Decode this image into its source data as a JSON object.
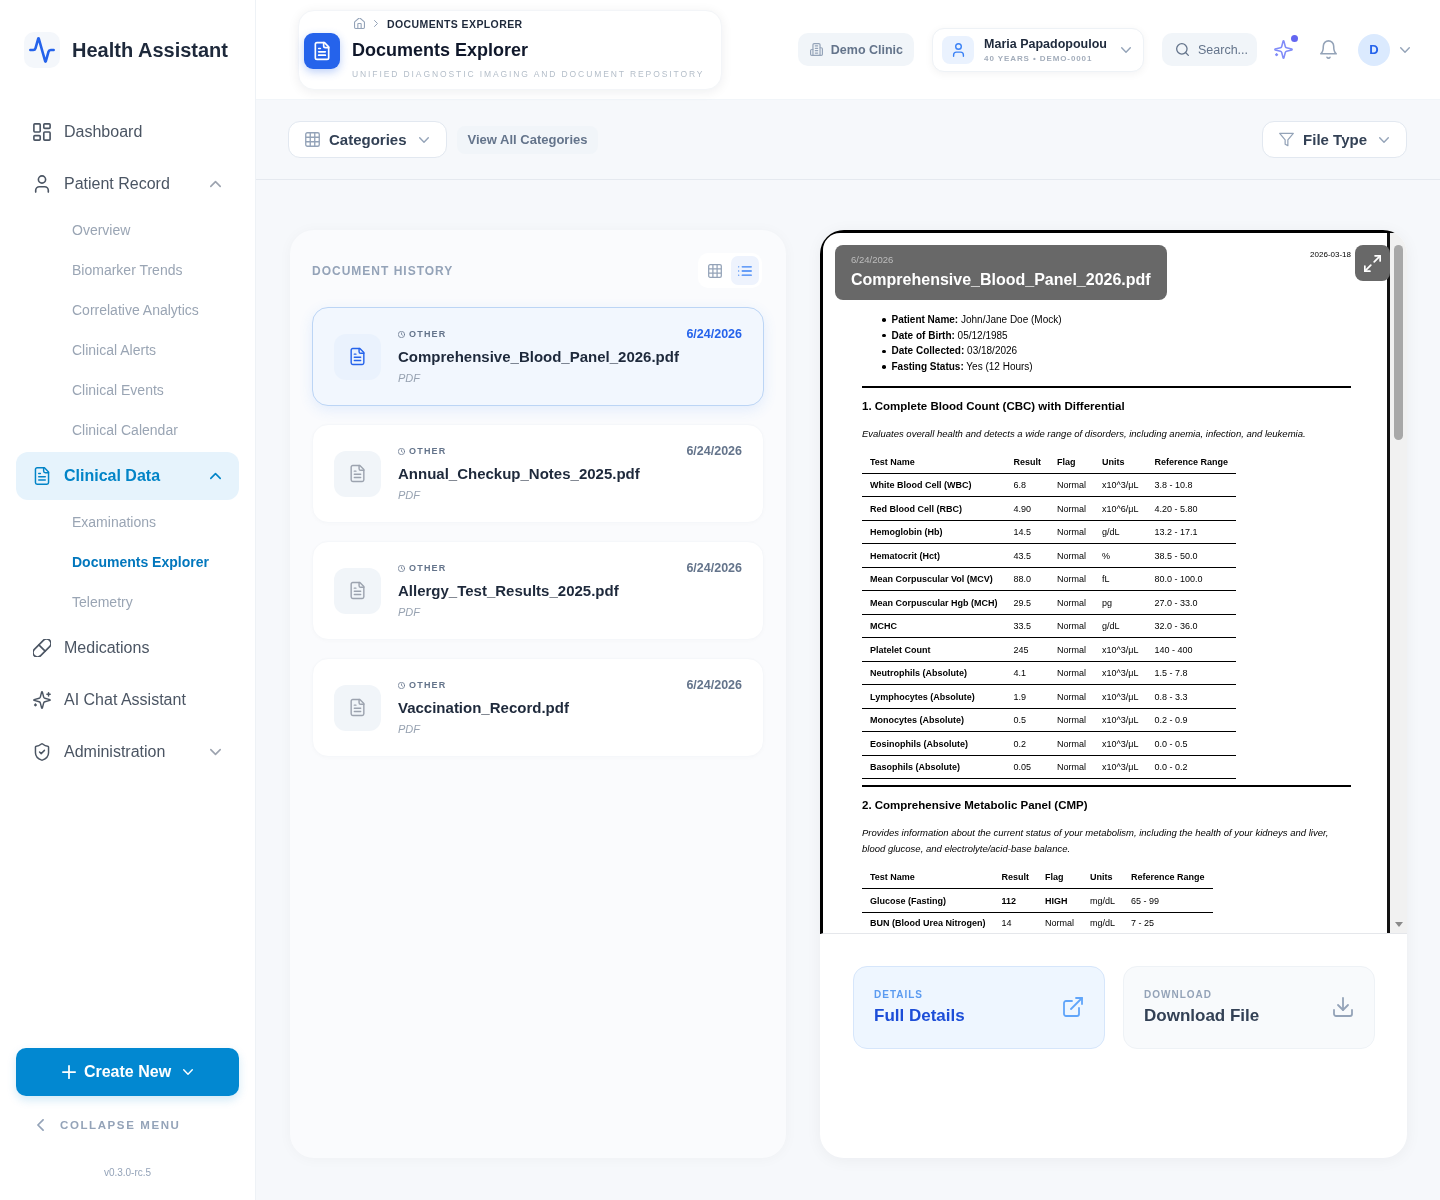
{
  "sidebar": {
    "brand": "Health Assistant",
    "nav": [
      {
        "kind": "link",
        "label": "Dashboard",
        "selected": false
      },
      {
        "kind": "group",
        "label": "Patient Record",
        "selected": false,
        "expanded": true,
        "children": [
          {
            "label": "Overview",
            "selected": false
          },
          {
            "label": "Biomarker Trends",
            "selected": false
          },
          {
            "label": "Correlative Analytics",
            "selected": false
          },
          {
            "label": "Clinical Alerts",
            "selected": false
          },
          {
            "label": "Clinical Events",
            "selected": false
          },
          {
            "label": "Clinical Calendar",
            "selected": false
          }
        ]
      },
      {
        "kind": "group",
        "label": "Clinical Data",
        "selected": true,
        "expanded": true,
        "children": [
          {
            "label": "Examinations",
            "selected": false
          },
          {
            "label": "Documents Explorer",
            "selected": true
          },
          {
            "label": "Telemetry",
            "selected": false
          }
        ]
      },
      {
        "kind": "link",
        "label": "Medications",
        "selected": false
      },
      {
        "kind": "link",
        "label": "AI Chat Assistant",
        "selected": false
      },
      {
        "kind": "group",
        "label": "Administration",
        "selected": false,
        "expanded": false
      }
    ],
    "create_button": "Create New",
    "collapse_label": "COLLAPSE MENU",
    "version": "v0.3.0-rc.5"
  },
  "header": {
    "breadcrumb": "DOCUMENTS EXPLORER",
    "title": "Documents Explorer",
    "subtitle": "UNIFIED DIAGNOSTIC IMAGING AND DOCUMENT REPOSITORY",
    "clinic": "Demo Clinic",
    "patient": {
      "name": "Maria Papadopoulou",
      "details": "40 YEARS • DEMO-0001"
    },
    "search": {
      "placeholder": "Search..."
    },
    "assistant_unread": true,
    "avatar": "D"
  },
  "toolbar": {
    "categories": "Categories",
    "view_all": "View All Categories",
    "file_type": "File Type"
  },
  "documents": {
    "heading": "DOCUMENT HISTORY",
    "view_modes": [
      {
        "kind": "grid",
        "selected": false
      },
      {
        "kind": "list",
        "selected": true
      }
    ],
    "items": [
      {
        "category": "OTHER",
        "name": "Comprehensive_Blood_Panel_2026.pdf",
        "type": "PDF",
        "date": "6/24/2026",
        "selected": true
      },
      {
        "category": "OTHER",
        "name": "Annual_Checkup_Notes_2025.pdf",
        "type": "PDF",
        "date": "6/24/2026",
        "selected": false
      },
      {
        "category": "OTHER",
        "name": "Allergy_Test_Results_2025.pdf",
        "type": "PDF",
        "date": "6/24/2026",
        "selected": false
      },
      {
        "category": "OTHER",
        "name": "Vaccination_Record.pdf",
        "type": "PDF",
        "date": "6/24/2026",
        "selected": false
      }
    ]
  },
  "preview": {
    "date": "6/24/2026",
    "title": "Comprehensive_Blood_Panel_2026.pdf",
    "document": {
      "date": "2026-03-18",
      "fields": [
        "**Patient Name:** John/Jane Doe (Mock)",
        "**Date of Birth:** 05/12/1985",
        "**Date Collected:** 03/18/2026",
        "**Fasting Status:** Yes (12 Hours)"
      ],
      "sections": [
        {
          "title": "1. Complete Blood Count (CBC) with Differential",
          "description": "Evaluates overall health and detects a wide range of disorders, including anemia, infection, and leukemia.",
          "columns": [
            "Test Name",
            "Result",
            "Flag",
            "Units",
            "Reference Range"
          ],
          "rows": [
            {
              "cells": [
                "White Blood Cell (WBC)",
                "6.8",
                "Normal",
                "x10^3/μL",
                "3.8 - 10.8"
              ],
              "abnormal": false
            },
            {
              "cells": [
                "Red Blood Cell (RBC)",
                "4.90",
                "Normal",
                "x10^6/μL",
                "4.20 - 5.80"
              ],
              "abnormal": false
            },
            {
              "cells": [
                "Hemoglobin (Hb)",
                "14.5",
                "Normal",
                "g/dL",
                "13.2 - 17.1"
              ],
              "abnormal": false
            },
            {
              "cells": [
                "Hematocrit (Hct)",
                "43.5",
                "Normal",
                "%",
                "38.5 - 50.0"
              ],
              "abnormal": false
            },
            {
              "cells": [
                "Mean Corpuscular Vol (MCV)",
                "88.0",
                "Normal",
                "fL",
                "80.0 - 100.0"
              ],
              "abnormal": false
            },
            {
              "cells": [
                "Mean Corpuscular Hgb (MCH)",
                "29.5",
                "Normal",
                "pg",
                "27.0 - 33.0"
              ],
              "abnormal": false
            },
            {
              "cells": [
                "MCHC",
                "33.5",
                "Normal",
                "g/dL",
                "32.0 - 36.0"
              ],
              "abnormal": false
            },
            {
              "cells": [
                "Platelet Count",
                "245",
                "Normal",
                "x10^3/μL",
                "140 - 400"
              ],
              "abnormal": false
            },
            {
              "cells": [
                "Neutrophils (Absolute)",
                "4.1",
                "Normal",
                "x10^3/μL",
                "1.5 - 7.8"
              ],
              "abnormal": false
            },
            {
              "cells": [
                "Lymphocytes (Absolute)",
                "1.9",
                "Normal",
                "x10^3/μL",
                "0.8 - 3.3"
              ],
              "abnormal": false
            },
            {
              "cells": [
                "Monocytes (Absolute)",
                "0.5",
                "Normal",
                "x10^3/μL",
                "0.2 - 0.9"
              ],
              "abnormal": false
            },
            {
              "cells": [
                "Eosinophils (Absolute)",
                "0.2",
                "Normal",
                "x10^3/μL",
                "0.0 - 0.5"
              ],
              "abnormal": false
            },
            {
              "cells": [
                "Basophils (Absolute)",
                "0.05",
                "Normal",
                "x10^3/μL",
                "0.0 - 0.2"
              ],
              "abnormal": false
            }
          ]
        },
        {
          "title": "2. Comprehensive Metabolic Panel (CMP)",
          "description": "Provides information about the current status of your metabolism, including the health of your kidneys and liver, blood glucose, and electrolyte/acid-base balance.",
          "columns": [
            "Test Name",
            "Result",
            "Flag",
            "Units",
            "Reference Range"
          ],
          "rows": [
            {
              "cells": [
                "Glucose (Fasting)",
                "112",
                "HIGH",
                "mg/dL",
                "65 - 99"
              ],
              "abnormal": true
            },
            {
              "cells": [
                "BUN (Blood Urea Nitrogen)",
                "14",
                "Normal",
                "mg/dL",
                "7 - 25"
              ],
              "abnormal": false
            }
          ]
        }
      ]
    },
    "actions": [
      {
        "kind": "details",
        "label": "DETAILS",
        "title": "Full Details"
      },
      {
        "kind": "download",
        "label": "DOWNLOAD",
        "title": "Download File"
      }
    ]
  }
}
